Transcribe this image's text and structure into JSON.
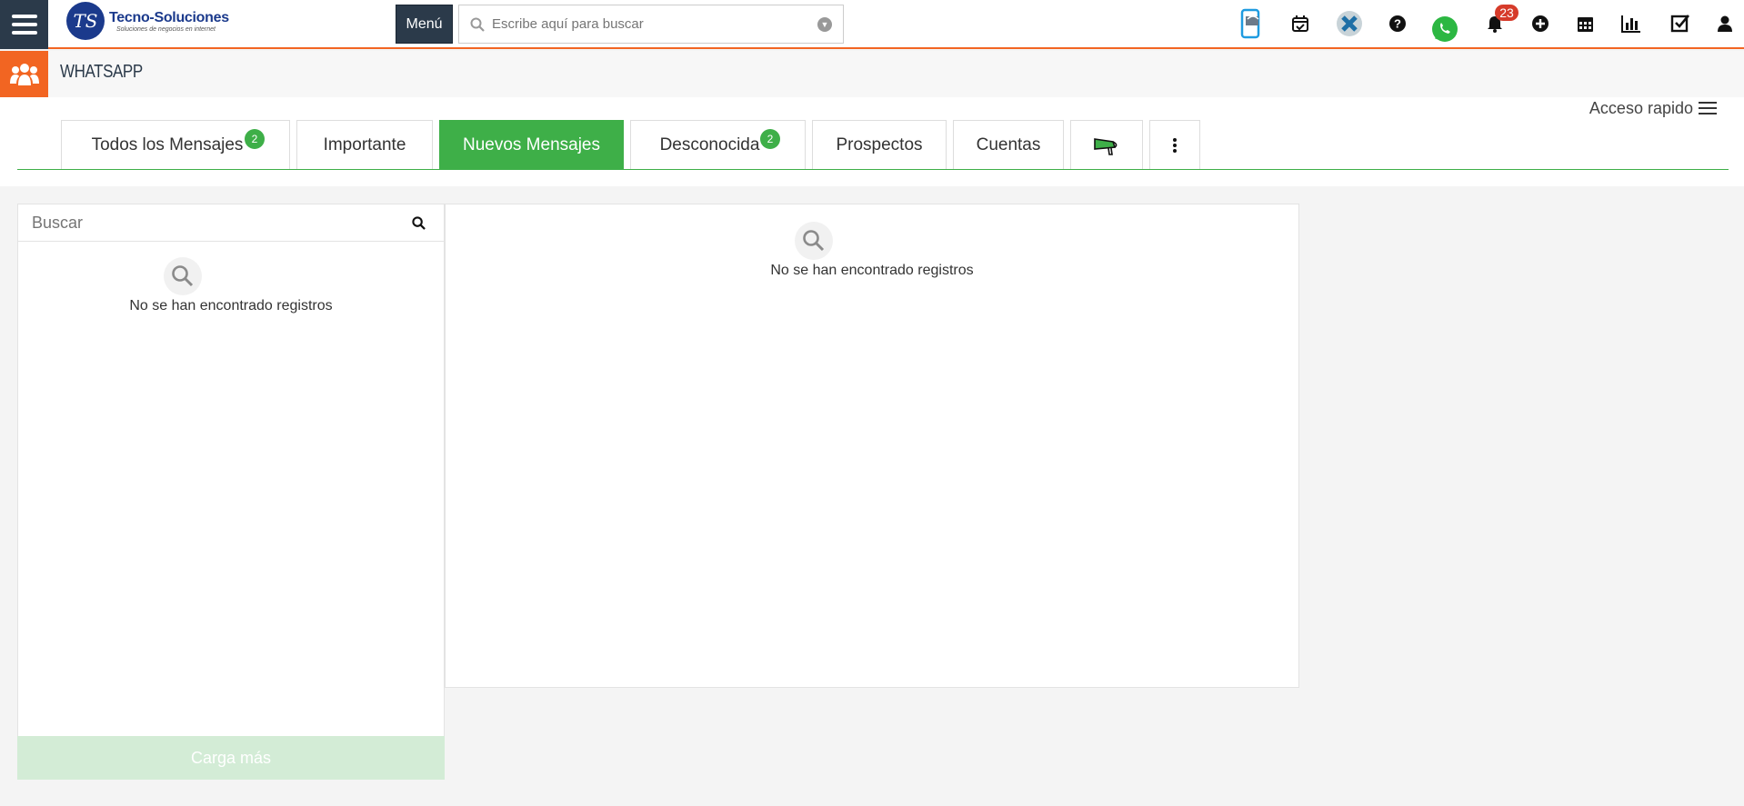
{
  "topbar": {
    "logo_title": "Tecno-Soluciones",
    "logo_subtitle": "Soluciones de negocios en internet",
    "menu_label": "Menú",
    "search_placeholder": "Escribe aquí para buscar",
    "notifications_count": "23",
    "icons": [
      "mobile-icon",
      "calendar-check-icon",
      "x-app-icon",
      "help-icon",
      "whatsapp-icon",
      "bell-icon",
      "plus-circle-icon",
      "calendar-icon",
      "bar-chart-icon",
      "checkbox-icon",
      "user-icon"
    ]
  },
  "page": {
    "title": "WHATSAPP",
    "quick_access": "Acceso rapido"
  },
  "tabs": [
    {
      "label": "Todos los Mensajes",
      "count": "2"
    },
    {
      "label": "Importante"
    },
    {
      "label": "Nuevos Mensajes"
    },
    {
      "label": "Desconocida",
      "count": "2"
    },
    {
      "label": "Prospectos"
    },
    {
      "label": "Cuentas"
    }
  ],
  "left": {
    "search_placeholder": "Buscar",
    "empty_text": "No se han encontrado registros",
    "load_more": "Carga más"
  },
  "right": {
    "empty_text": "No se han encontrado registros"
  },
  "colors": {
    "accent_green": "#3eaf48",
    "accent_orange": "#f26522",
    "dark_navy": "#2b3a4a",
    "badge_red": "#d63b2a"
  }
}
